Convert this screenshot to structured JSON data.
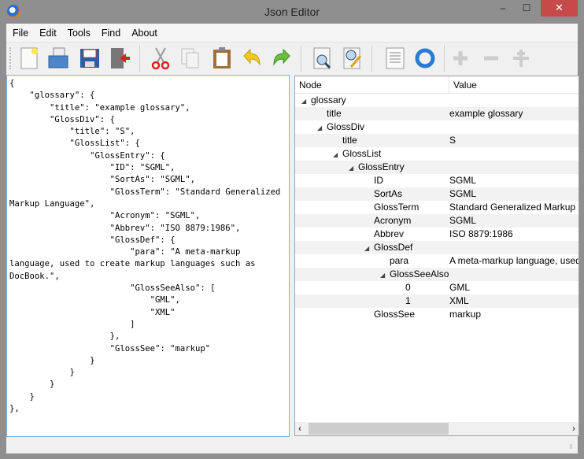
{
  "window": {
    "title": "Json Editor",
    "minimize": "‒",
    "maximize": "☐",
    "close": "✕"
  },
  "menu": [
    "File",
    "Edit",
    "Tools",
    "Find",
    "About"
  ],
  "toolbar": [
    "new-file",
    "open-folder",
    "save",
    "exit",
    "cut",
    "copy",
    "paste",
    "undo",
    "redo",
    "find",
    "find-replace",
    "format",
    "refresh",
    "add",
    "remove",
    "insert"
  ],
  "editor": {
    "text": "{\n    \"glossary\": {\n        \"title\": \"example glossary\",\n        \"GlossDiv\": {\n            \"title\": \"S\",\n            \"GlossList\": {\n                \"GlossEntry\": {\n                    \"ID\": \"SGML\",\n                    \"SortAs\": \"SGML\",\n                    \"GlossTerm\": \"Standard Generalized Markup Language\",\n                    \"Acronym\": \"SGML\",\n                    \"Abbrev\": \"ISO 8879:1986\",\n                    \"GlossDef\": {\n                        \"para\": \"A meta-markup language, used to create markup languages such as DocBook.\",\n                        \"GlossSeeAlso\": [\n                            \"GML\",\n                            \"XML\"\n                        ]\n                    },\n                    \"GlossSee\": \"markup\"\n                }\n            }\n        }\n    }\n},"
  },
  "tree": {
    "headers": {
      "node": "Node",
      "value": "Value"
    },
    "rows": [
      {
        "node": "glossary",
        "value": "",
        "level": 0,
        "expanded": true
      },
      {
        "node": "title",
        "value": "example glossary",
        "level": 1
      },
      {
        "node": "GlossDiv",
        "value": "",
        "level": 1,
        "expanded": true
      },
      {
        "node": "title",
        "value": "S",
        "level": 2
      },
      {
        "node": "GlossList",
        "value": "",
        "level": 2,
        "expanded": true
      },
      {
        "node": "GlossEntry",
        "value": "",
        "level": 3,
        "expanded": true
      },
      {
        "node": "ID",
        "value": "SGML",
        "level": 4
      },
      {
        "node": "SortAs",
        "value": "SGML",
        "level": 4
      },
      {
        "node": "GlossTerm",
        "value": "Standard Generalized Markup Language",
        "level": 4
      },
      {
        "node": "Acronym",
        "value": "SGML",
        "level": 4
      },
      {
        "node": "Abbrev",
        "value": "ISO 8879:1986",
        "level": 4
      },
      {
        "node": "GlossDef",
        "value": "",
        "level": 4,
        "expanded": true
      },
      {
        "node": "para",
        "value": "A meta-markup language, used to create markup languages such as DocBook.",
        "level": 5
      },
      {
        "node": "GlossSeeAlso",
        "value": "",
        "level": 5,
        "expanded": true
      },
      {
        "node": "0",
        "value": "GML",
        "level": 6
      },
      {
        "node": "1",
        "value": "XML",
        "level": 6
      },
      {
        "node": "GlossSee",
        "value": "markup",
        "level": 4
      }
    ]
  }
}
